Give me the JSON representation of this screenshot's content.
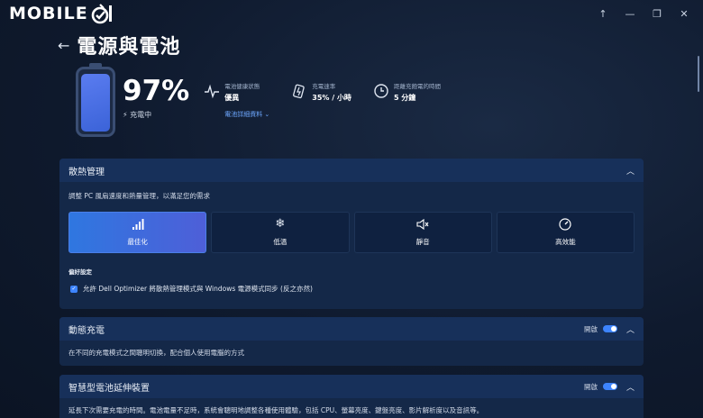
{
  "window": {
    "logo_text": "MOBILE",
    "controls": {
      "back": "↑",
      "minimize": "—",
      "restore": "❐",
      "close": "✕"
    }
  },
  "page": {
    "back_glyph": "←",
    "title": "電源與電池"
  },
  "battery": {
    "level_fraction": 0.97,
    "percent": "97%",
    "status": "充電中",
    "health": {
      "label": "電池健康狀態",
      "value": "優異",
      "link": "電池詳細資料 ⌄"
    },
    "rate": {
      "label": "充電速率",
      "value": "35% / 小時"
    },
    "time": {
      "label": "距離充飽電的時間",
      "value": "5 分鐘"
    }
  },
  "thermal": {
    "title": "散熱管理",
    "description": "調整 PC 風扇速度和熱量管理，以滿足您的需求",
    "modes": [
      {
        "label": "最佳化",
        "icon": "optimized-icon",
        "active": true
      },
      {
        "label": "低溫",
        "icon": "snowflake-icon",
        "active": false
      },
      {
        "label": "靜音",
        "icon": "mute-icon",
        "active": false
      },
      {
        "label": "高效能",
        "icon": "gauge-icon",
        "active": false
      }
    ],
    "prefs_heading": "偏好設定",
    "pref_sync": "允許 Dell Optimizer 將散熱管理模式與 Windows 電源模式同步 (反之亦然)"
  },
  "dynamic_charging": {
    "title": "動態充電",
    "toggle_label": "開啟",
    "toggle_on": true,
    "description": "在不同的充電模式之間聰明切換，配合個人使用電腦的方式"
  },
  "battery_extender": {
    "title": "智慧型電池延伸裝置",
    "toggle_label": "開啟",
    "toggle_on": true,
    "description": "延長下次需要充電的時間。電池電量不足時，系統會聰明地調整各種使用體驗，包括 CPU、螢幕亮度、鍵盤亮度、影片解析度以及音訊等。"
  },
  "colors": {
    "accent": "#3d84ff",
    "panel": "#142848",
    "panel_header": "#17305a",
    "active_mode": "#2f77e0"
  }
}
